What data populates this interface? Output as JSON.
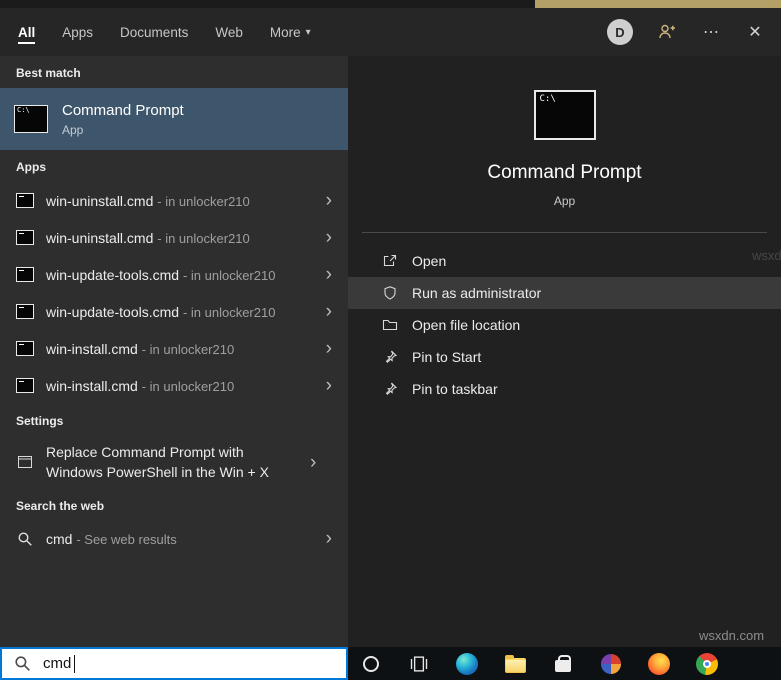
{
  "icons": {
    "chevron_down": "▾",
    "chevron_right": "›",
    "ellipsis": "⋯",
    "close": "✕",
    "cmd_text": "C:\\"
  },
  "header": {
    "tabs": [
      {
        "label": "All"
      },
      {
        "label": "Apps"
      },
      {
        "label": "Documents"
      },
      {
        "label": "Web"
      },
      {
        "label": "More"
      }
    ],
    "avatar_letter": "D"
  },
  "left_panel": {
    "sections": {
      "best_match_label": "Best match",
      "apps_label": "Apps",
      "settings_label": "Settings",
      "web_label": "Search the web"
    },
    "best_match": {
      "title": "Command Prompt",
      "subtitle": "App"
    },
    "app_items": [
      {
        "name": "win-uninstall.cmd",
        "context": "- in unlocker210"
      },
      {
        "name": "win-uninstall.cmd",
        "context": "- in unlocker210"
      },
      {
        "name": "win-update-tools.cmd",
        "context": "- in unlocker210"
      },
      {
        "name": "win-update-tools.cmd",
        "context": "- in unlocker210"
      },
      {
        "name": "win-install.cmd",
        "context": "- in unlocker210"
      },
      {
        "name": "win-install.cmd",
        "context": "- in unlocker210"
      }
    ],
    "settings_item": "Replace Command Prompt with Windows PowerShell in the Win + X",
    "web_item": {
      "name": "cmd",
      "context": "- See web results"
    }
  },
  "preview_panel": {
    "title": "Command Prompt",
    "subtitle": "App",
    "actions": [
      "Open",
      "Run as administrator",
      "Open file location",
      "Pin to Start",
      "Pin to taskbar"
    ]
  },
  "search_box": {
    "value": "cmd"
  },
  "taskbar": {
    "items": [
      "cortana",
      "task-view",
      "edge",
      "file-explorer",
      "store",
      "colorful-app",
      "firefox",
      "chrome"
    ]
  },
  "watermark": "wsxdn.com",
  "colors": {
    "accent": "#0078d7",
    "best_match_highlight": "#3e566b",
    "action_highlight": "#3a3a3a"
  }
}
